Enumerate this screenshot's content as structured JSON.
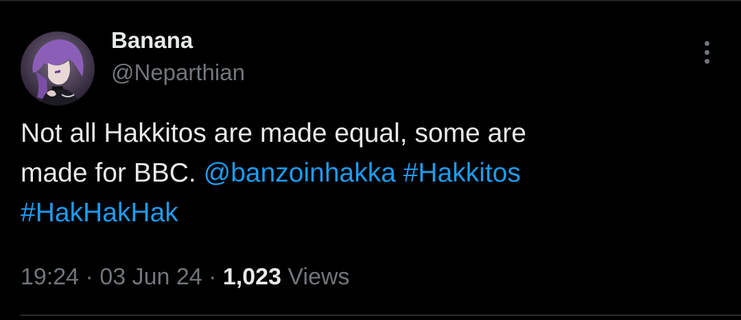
{
  "author": {
    "display_name": "Banana",
    "handle": "@Neparthian",
    "avatar_icon": "anime-character-avatar"
  },
  "tweet": {
    "line1": "Not all Hakkitos are made equal, some are",
    "line2_text": "made for BBC. ",
    "mention": "@banzoinhakka",
    "hashtag1": "#Hakkitos",
    "hashtag2": "#HakHakHak"
  },
  "meta": {
    "time": "19:24",
    "separator": "·",
    "date": "03 Jun 24",
    "views_count": "1,023",
    "views_label": "Views"
  },
  "colors": {
    "background": "#000000",
    "text": "#e7e9ea",
    "secondary": "#71767b",
    "link": "#1d9bf0"
  },
  "more_icon": "more-vertical-icon"
}
